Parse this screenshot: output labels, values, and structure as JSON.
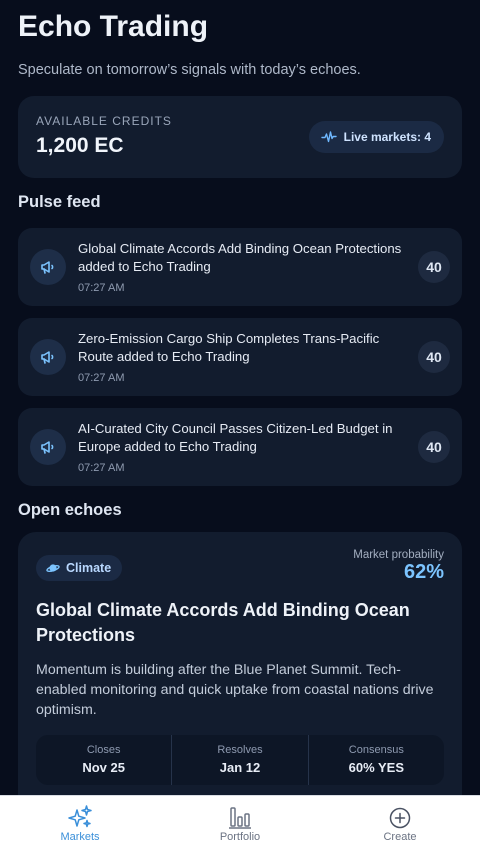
{
  "header": {
    "title": "Echo Trading",
    "subtitle": "Speculate on tomorrow’s signals with today’s echoes."
  },
  "credits": {
    "label": "AVAILABLE CREDITS",
    "value": "1,200 EC",
    "live_markets": "Live markets: 4",
    "live_icon": "pulse-line-icon"
  },
  "pulse_feed": {
    "title": "Pulse feed",
    "items": [
      {
        "text": "Global Climate Accords Add Binding Ocean Protections added to Echo Trading",
        "time": "07:27 AM",
        "score": "40",
        "icon": "megaphone-icon"
      },
      {
        "text": "Zero-Emission Cargo Ship Completes Trans-Pacific Route added to Echo Trading",
        "time": "07:27 AM",
        "score": "40",
        "icon": "megaphone-icon"
      },
      {
        "text": "AI-Curated City Council Passes Citizen-Led Budget in Europe added to Echo Trading",
        "time": "07:27 AM",
        "score": "40",
        "icon": "megaphone-icon"
      }
    ]
  },
  "open_echoes": {
    "title": "Open echoes",
    "cards": [
      {
        "tag": "Climate",
        "tag_icon": "planet-icon",
        "prob_label": "Market probability",
        "prob_value": "62%",
        "title": "Global Climate Accords Add Binding Ocean Protections",
        "description": "Momentum is building after the Blue Planet Summit. Tech-enabled monitoring and quick uptake from coastal nations drive optimism.",
        "stats": [
          {
            "label": "Closes",
            "value": "Nov 25"
          },
          {
            "label": "Resolves",
            "value": "Jan 12"
          },
          {
            "label": "Consensus",
            "value": "60% YES"
          }
        ]
      }
    ]
  },
  "nav": {
    "items": [
      {
        "label": "Markets",
        "icon": "sparkles-icon",
        "active": true
      },
      {
        "label": "Portfolio",
        "icon": "bar-chart-icon",
        "active": false
      },
      {
        "label": "Create",
        "icon": "plus-circle-icon",
        "active": false
      }
    ]
  },
  "colors": {
    "background": "#070d1c",
    "card": "#121c2e",
    "accent": "#7cc4ff",
    "nav_active": "#3a8fd9"
  }
}
